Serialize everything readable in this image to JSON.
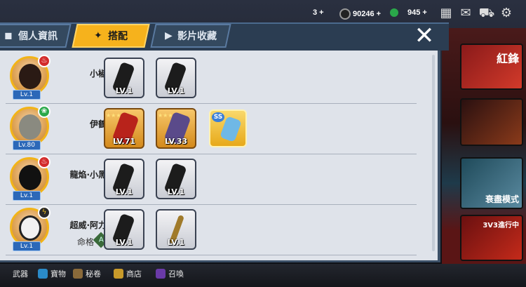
{
  "topbar": {
    "resource1": {
      "value": "3",
      "icon": "spiral-icon"
    },
    "resource2": {
      "value": "90246",
      "icon": "coin-icon"
    },
    "resource3": {
      "value": "945",
      "icon": "gem-icon"
    },
    "plus": "+"
  },
  "tabs": [
    {
      "label": "個人資訊",
      "icon": "profile-icon",
      "active": false
    },
    {
      "label": "搭配",
      "icon": "shuriken-icon",
      "active": true
    },
    {
      "label": "影片收藏",
      "icon": "play-icon",
      "active": false
    }
  ],
  "close_label": "✕",
  "characters": [
    {
      "name": "小椒",
      "level": "Lv.1",
      "element_color": "#d32b2b",
      "element_glyph": "♨",
      "items": [
        {
          "level": "LV.1",
          "style": "silver",
          "stars": 0
        },
        {
          "level": "LV.1",
          "style": "silver",
          "stars": 0
        }
      ]
    },
    {
      "name": "伊鶴",
      "level": "Lv.80",
      "element_color": "#2aa84a",
      "element_glyph": "❀",
      "items": [
        {
          "level": "LV.71",
          "style": "gold",
          "stars": 4
        },
        {
          "level": "LV.33",
          "style": "gold",
          "stars": 4
        },
        {
          "level": "",
          "style": "ss",
          "tag": "SS",
          "stars": 0
        }
      ]
    },
    {
      "name": "龍焰·小黑",
      "level": "Lv.1",
      "element_color": "#d32b2b",
      "element_glyph": "♨",
      "items": [
        {
          "level": "LV.1",
          "style": "silver",
          "stars": 0
        },
        {
          "level": "LV.1",
          "style": "silver",
          "stars": 0
        }
      ]
    },
    {
      "name": "超威·阿力",
      "level": "Lv.1",
      "element_color": "#2a2a2a",
      "element_glyph": "ϟ",
      "sub_label": "命格",
      "sub_badge": "A",
      "items": [
        {
          "level": "LV.1",
          "style": "silver",
          "stars": 0
        },
        {
          "level": "LV.1",
          "style": "silver",
          "stars": 0
        }
      ]
    }
  ],
  "bottom_nav": [
    {
      "label": "武器",
      "icon": "weapon-icon"
    },
    {
      "label": "寶物",
      "icon": "treasure-icon"
    },
    {
      "label": "秘卷",
      "icon": "scroll-icon"
    },
    {
      "label": "商店",
      "icon": "shop-icon"
    },
    {
      "label": "召喚",
      "icon": "summon-icon"
    }
  ],
  "promos": [
    "紅鋒",
    "衰盡模式",
    "3V3進行中"
  ],
  "colors": {
    "accent": "#f6b21c",
    "panel": "#dfe3ea",
    "tabbar": "#2b3d52",
    "lv_badge": "#2c68b8"
  }
}
